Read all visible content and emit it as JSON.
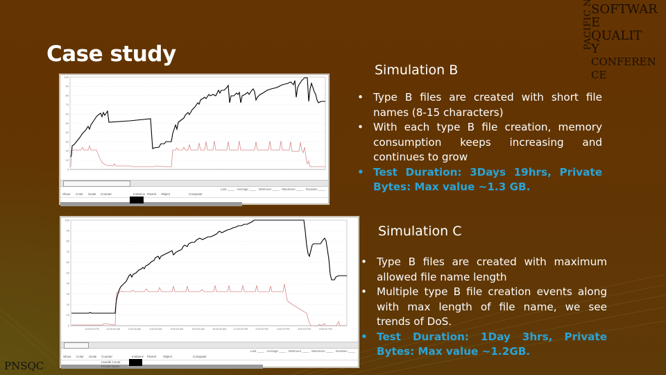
{
  "slide": {
    "title": "Case study",
    "footer_logo": "PNSQC",
    "conference_logo": {
      "vertical_text": "PACIFIC NW",
      "lines": [
        "SOFTWAR",
        "E",
        "QUALIT",
        "Y",
        "CONFEREN",
        "CE"
      ]
    }
  },
  "simulation_b": {
    "title": "Simulation B",
    "bullets": [
      {
        "text": "Type B files are created with short file names (8-15 characters)",
        "highlight": false
      },
      {
        "text": "With each type B file creation, memory consumption keeps increasing and continues to grow",
        "highlight": false
      },
      {
        "text": "Test Duration: 3Days 19hrs, Private Bytes: Max value ~1.3 GB.",
        "highlight": true
      }
    ],
    "screenshot": {
      "y_ticks": [
        "100",
        "90",
        "80",
        "70",
        "60",
        "50",
        "40",
        "30",
        "20",
        "10",
        "0"
      ],
      "legend_headers": [
        "Show",
        "Color",
        "Scale",
        "Counter",
        "Instance",
        "Parent",
        "Object",
        "Computer"
      ],
      "stats_labels": [
        "Last",
        "Average",
        "Minimum",
        "Maximum",
        "Duration"
      ]
    }
  },
  "simulation_c": {
    "title": "Simulation C",
    "bullets": [
      {
        "text": "Type B files are created with maximum allowed file name length",
        "highlight": false
      },
      {
        "text": "Multiple type B file creation events along with max length of file name, we see trends of DoS.",
        "highlight": false
      },
      {
        "text": "Test Duration: 1Day 3hrs, Private Bytes: Max value ~1.2GB.",
        "highlight": true
      }
    ],
    "screenshot": {
      "y_ticks": [
        "100",
        "90",
        "80",
        "70",
        "60",
        "50",
        "40",
        "30",
        "20",
        "10",
        "0"
      ],
      "x_ticks": [
        "10:00:00 PM",
        "12:00:00 AM",
        "2:00:00 AM",
        "4:00:00 AM",
        "6:00:00 AM",
        "8:00:00 AM",
        "10:00:00 AM",
        "12:00:00 PM",
        "2:00:00 PM",
        "4:00:00 PM",
        "6:00:00 PM",
        "8:00:00 PM"
      ],
      "legend_headers": [
        "Show",
        "Color",
        "Scale",
        "Counter",
        "Instance",
        "Parent",
        "Object",
        "Computer"
      ],
      "counters": [
        "Handle Count",
        "Private Bytes"
      ],
      "stats_labels": [
        "Last",
        "Average",
        "Minimum",
        "Maximum",
        "Duration"
      ]
    }
  },
  "colors": {
    "background": "#613503",
    "title_text": "#ffffff",
    "highlight_text": "#2ba4d6",
    "private_bytes_line": "#000000",
    "handle_count_line": "#d88a8a"
  }
}
